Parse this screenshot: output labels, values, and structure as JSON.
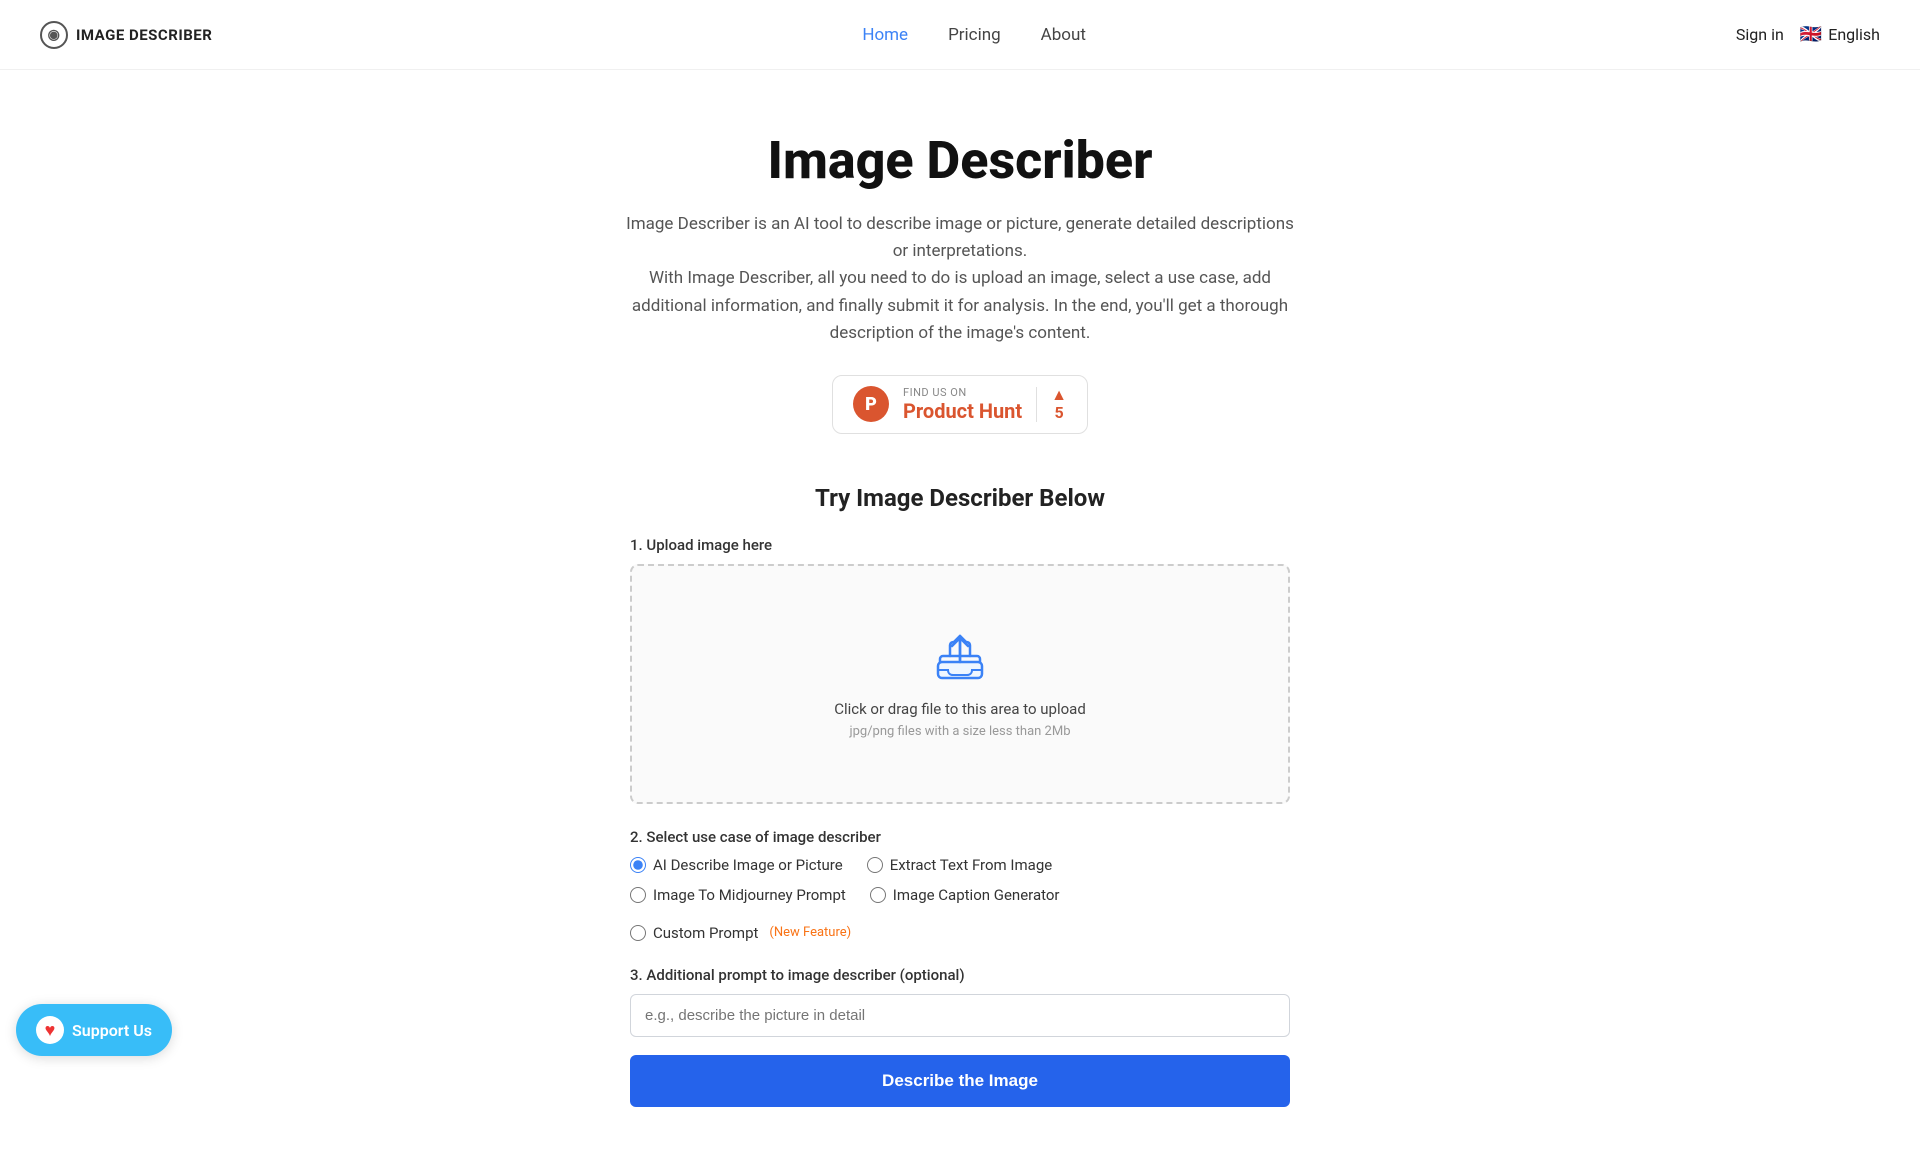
{
  "nav": {
    "logo_text": "IMAGE DESCRIBER",
    "links": [
      {
        "label": "Home",
        "href": "#",
        "active": true
      },
      {
        "label": "Pricing",
        "href": "#",
        "active": false
      },
      {
        "label": "About",
        "href": "#",
        "active": false
      }
    ],
    "signin_label": "Sign in",
    "language": "English"
  },
  "hero": {
    "title": "Image Describer",
    "description_line1": "Image Describer is an AI tool to describe image or picture, generate detailed descriptions or interpretations.",
    "description_line2": "With Image Describer, all you need to do is upload an image, select a use case, add additional information, and finally submit it for analysis. In the end, you'll get a thorough description of the image's content."
  },
  "product_hunt": {
    "find_us_label": "FIND US ON",
    "name": "Product Hunt",
    "votes": "5"
  },
  "main": {
    "try_title": "Try Image Describer Below",
    "step1_label": "1. Upload image here",
    "upload_click": "Click or drag file to this area to upload",
    "upload_hint": "jpg/png files with a size less than 2Mb",
    "step2_label": "2. Select use case of image describer",
    "radio_options": [
      {
        "id": "ai-describe",
        "label": "AI Describe Image or Picture",
        "checked": true
      },
      {
        "id": "extract-text",
        "label": "Extract Text From Image",
        "checked": false
      },
      {
        "id": "midjourney",
        "label": "Image To Midjourney Prompt",
        "checked": false
      },
      {
        "id": "caption",
        "label": "Image Caption Generator",
        "checked": false
      },
      {
        "id": "custom",
        "label": "Custom Prompt",
        "checked": false,
        "badge": "(New Feature)"
      }
    ],
    "step3_label": "3. Additional prompt to image describer (optional)",
    "prompt_placeholder": "e.g., describe the picture in detail",
    "submit_label": "Describe the Image"
  },
  "support": {
    "label": "Support Us"
  }
}
